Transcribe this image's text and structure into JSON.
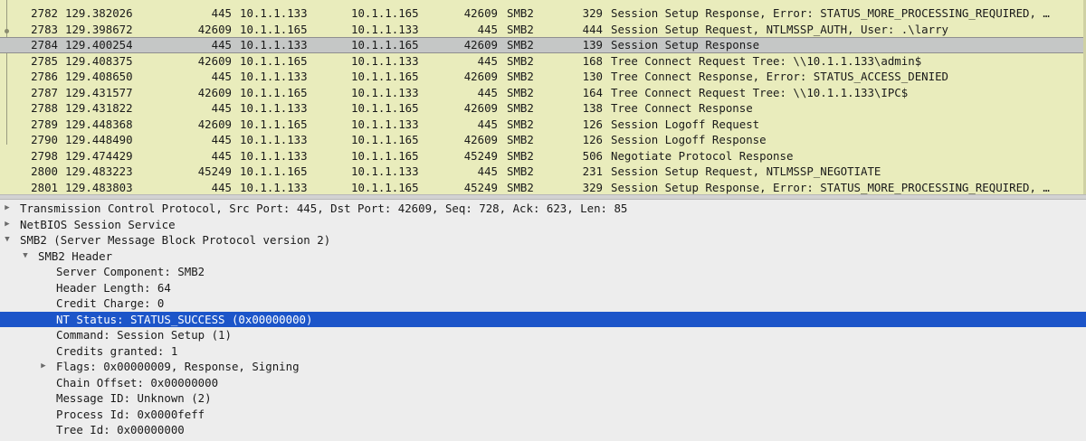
{
  "packet_list": {
    "rows": [
      {
        "no": "2782",
        "time": "129.382026",
        "sport": "445",
        "src": "10.1.1.133",
        "dst": "10.1.1.165",
        "dport": "42609",
        "proto": "SMB2",
        "len": "329",
        "info": "Session Setup Response, Error: STATUS_MORE_PROCESSING_REQUIRED, …"
      },
      {
        "no": "2783",
        "time": "129.398672",
        "sport": "42609",
        "src": "10.1.1.165",
        "dst": "10.1.1.133",
        "dport": "445",
        "proto": "SMB2",
        "len": "444",
        "info": "Session Setup Request, NTLMSSP_AUTH, User: .\\larry"
      },
      {
        "no": "2784",
        "time": "129.400254",
        "sport": "445",
        "src": "10.1.1.133",
        "dst": "10.1.1.165",
        "dport": "42609",
        "proto": "SMB2",
        "len": "139",
        "info": "Session Setup Response",
        "selected": true
      },
      {
        "no": "2785",
        "time": "129.408375",
        "sport": "42609",
        "src": "10.1.1.165",
        "dst": "10.1.1.133",
        "dport": "445",
        "proto": "SMB2",
        "len": "168",
        "info": "Tree Connect Request Tree: \\\\10.1.1.133\\admin$"
      },
      {
        "no": "2786",
        "time": "129.408650",
        "sport": "445",
        "src": "10.1.1.133",
        "dst": "10.1.1.165",
        "dport": "42609",
        "proto": "SMB2",
        "len": "130",
        "info": "Tree Connect Response, Error: STATUS_ACCESS_DENIED"
      },
      {
        "no": "2787",
        "time": "129.431577",
        "sport": "42609",
        "src": "10.1.1.165",
        "dst": "10.1.1.133",
        "dport": "445",
        "proto": "SMB2",
        "len": "164",
        "info": "Tree Connect Request Tree: \\\\10.1.1.133\\IPC$"
      },
      {
        "no": "2788",
        "time": "129.431822",
        "sport": "445",
        "src": "10.1.1.133",
        "dst": "10.1.1.165",
        "dport": "42609",
        "proto": "SMB2",
        "len": "138",
        "info": "Tree Connect Response"
      },
      {
        "no": "2789",
        "time": "129.448368",
        "sport": "42609",
        "src": "10.1.1.165",
        "dst": "10.1.1.133",
        "dport": "445",
        "proto": "SMB2",
        "len": "126",
        "info": "Session Logoff Request"
      },
      {
        "no": "2790",
        "time": "129.448490",
        "sport": "445",
        "src": "10.1.1.133",
        "dst": "10.1.1.165",
        "dport": "42609",
        "proto": "SMB2",
        "len": "126",
        "info": "Session Logoff Response"
      },
      {
        "no": "2798",
        "time": "129.474429",
        "sport": "445",
        "src": "10.1.1.133",
        "dst": "10.1.1.165",
        "dport": "45249",
        "proto": "SMB2",
        "len": "506",
        "info": "Negotiate Protocol Response"
      },
      {
        "no": "2800",
        "time": "129.483223",
        "sport": "45249",
        "src": "10.1.1.165",
        "dst": "10.1.1.133",
        "dport": "445",
        "proto": "SMB2",
        "len": "231",
        "info": "Session Setup Request, NTLMSSP_NEGOTIATE"
      },
      {
        "no": "2801",
        "time": "129.483803",
        "sport": "445",
        "src": "10.1.1.133",
        "dst": "10.1.1.165",
        "dport": "45249",
        "proto": "SMB2",
        "len": "329",
        "info": "Session Setup Response, Error: STATUS_MORE_PROCESSING_REQUIRED, …"
      }
    ]
  },
  "details": {
    "rows": [
      {
        "text": "Transmission Control Protocol, Src Port: 445, Dst Port: 42609, Seq: 728, Ack: 623, Len: 85",
        "arrow": "collapsed",
        "level": 0
      },
      {
        "text": "NetBIOS Session Service",
        "arrow": "collapsed",
        "level": 0
      },
      {
        "text": "SMB2 (Server Message Block Protocol version 2)",
        "arrow": "expanded",
        "level": 0
      },
      {
        "text": "SMB2 Header",
        "arrow": "expanded",
        "level": 1
      },
      {
        "text": "Server Component: SMB2",
        "arrow": "none",
        "level": 2
      },
      {
        "text": "Header Length: 64",
        "arrow": "none",
        "level": 2
      },
      {
        "text": "Credit Charge: 0",
        "arrow": "none",
        "level": 2
      },
      {
        "text": "NT Status: STATUS_SUCCESS (0x00000000)",
        "arrow": "none",
        "level": 2,
        "selected": true
      },
      {
        "text": "Command: Session Setup (1)",
        "arrow": "none",
        "level": 2
      },
      {
        "text": "Credits granted: 1",
        "arrow": "none",
        "level": 2
      },
      {
        "text": "Flags: 0x00000009, Response, Signing",
        "arrow": "collapsed",
        "level": 2
      },
      {
        "text": "Chain Offset: 0x00000000",
        "arrow": "none",
        "level": 2
      },
      {
        "text": "Message ID: Unknown (2)",
        "arrow": "none",
        "level": 2
      },
      {
        "text": "Process Id: 0x0000feff",
        "arrow": "none",
        "level": 2
      },
      {
        "text": "Tree Id: 0x00000000",
        "arrow": "none",
        "level": 2
      }
    ]
  },
  "colors": {
    "list_background": "#e9ecbc",
    "list_selected": "#c5c7c6",
    "details_background": "#ededed",
    "details_selected": "#1c55c9"
  }
}
